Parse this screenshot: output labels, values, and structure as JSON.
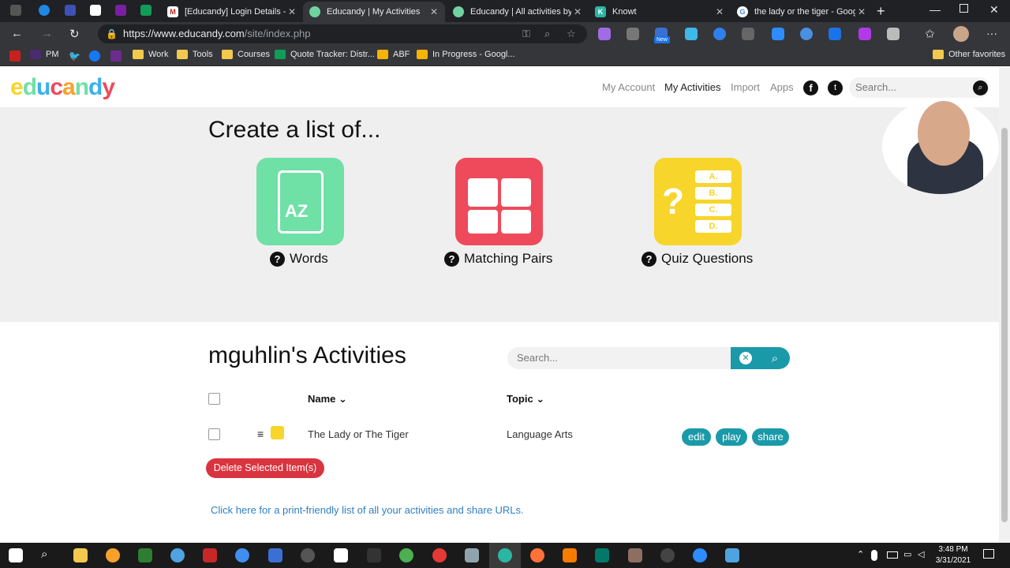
{
  "browser": {
    "tabs": [
      {
        "title": "[Educandy] Login Details - m"
      },
      {
        "title": "Educandy | My Activities"
      },
      {
        "title": "Educandy | All activities by m"
      },
      {
        "title": "Knowt"
      },
      {
        "title": "the lady or the tiger - Googl"
      }
    ],
    "url_host": "https://www.educandy.com",
    "url_path": "/site/index.php",
    "bookmarks": [
      "PM",
      "Work",
      "Tools",
      "Courses",
      "Quote Tracker: Distr...",
      "ABF",
      "In Progress - Googl..."
    ],
    "other_favorites": "Other favorites",
    "ext_badge": "New"
  },
  "site": {
    "logo": "educandy",
    "nav": [
      "My Account",
      "My Activities",
      "Import",
      "Apps"
    ],
    "search_placeholder": "Search..."
  },
  "create": {
    "title": "Create a list of...",
    "types": [
      {
        "label": "Words",
        "color": "#6fe0a6"
      },
      {
        "label": "Matching Pairs",
        "color": "#ee4a5c"
      },
      {
        "label": "Quiz Questions",
        "color": "#f7d52a"
      }
    ],
    "quiz_letters": [
      "A.",
      "B.",
      "C.",
      "D."
    ],
    "az": "AZ"
  },
  "activities": {
    "title": "mguhlin's Activities",
    "search_placeholder": "Search...",
    "columns": {
      "name": "Name",
      "topic": "Topic"
    },
    "rows": [
      {
        "name": "The Lady or The Tiger",
        "topic": "Language Arts",
        "actions": [
          "edit",
          "play",
          "share"
        ]
      }
    ],
    "delete_label": "Delete Selected Item(s)",
    "print_link": "Click here for a print-friendly list of all your activities and share URLs."
  },
  "taskbar": {
    "time": "3:48 PM",
    "date": "3/31/2021"
  },
  "colors": {
    "accent": "#1a9aa8",
    "danger": "#d9343f",
    "link": "#2f7fc1"
  }
}
